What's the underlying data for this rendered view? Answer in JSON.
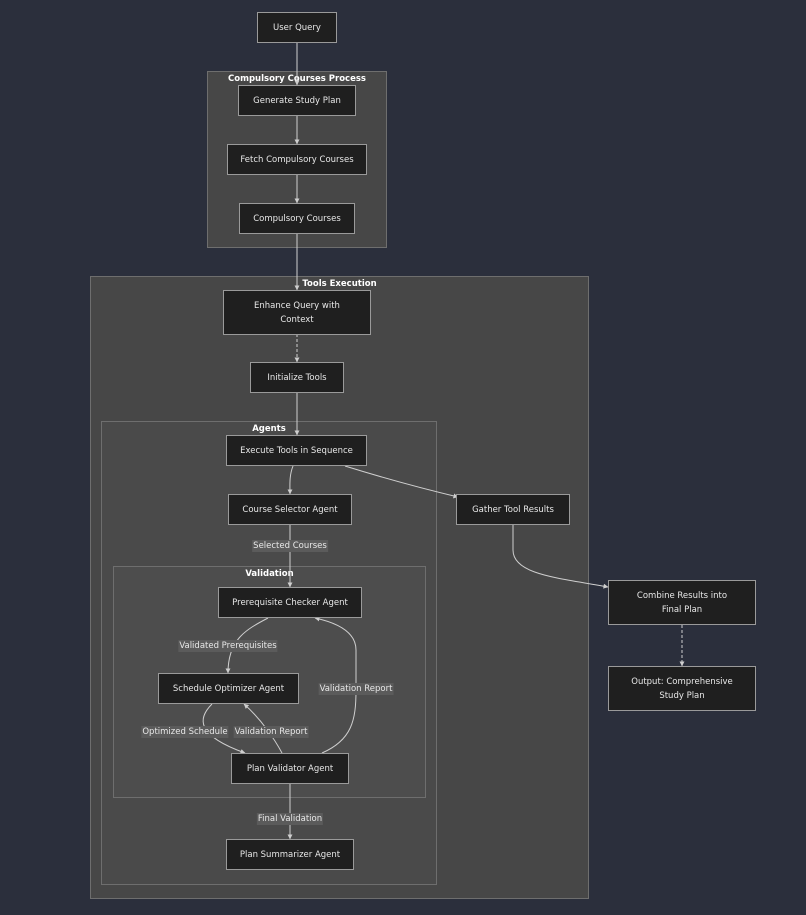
{
  "clusters": {
    "compulsory": {
      "title": "Compulsory Courses Process"
    },
    "tools": {
      "title": "Tools Execution"
    },
    "agents": {
      "title": "Agents"
    },
    "validation": {
      "title": "Validation"
    }
  },
  "nodes": {
    "user_query": "User Query",
    "generate_plan": "Generate Study Plan",
    "fetch_compulsory": "Fetch Compulsory Courses",
    "compulsory_courses": "Compulsory Courses",
    "enhance_query": "Enhance Query with Context",
    "init_tools": "Initialize Tools",
    "exec_tools": "Execute Tools in Sequence",
    "course_selector": "Course Selector Agent",
    "gather_results": "Gather Tool Results",
    "prereq_checker": "Prerequisite Checker Agent",
    "schedule_optimizer": "Schedule Optimizer Agent",
    "plan_validator": "Plan Validator Agent",
    "plan_summarizer": "Plan Summarizer Agent",
    "combine_results": "Combine Results into Final Plan",
    "output": "Output: Comprehensive Study Plan"
  },
  "edge_labels": {
    "selected_courses": "Selected Courses",
    "validated_prereqs": "Validated Prerequisites",
    "validation_report_right": "Validation Report",
    "optimized_schedule": "Optimized Schedule",
    "validation_report_mid": "Validation Report",
    "final_validation": "Final Validation"
  },
  "colors": {
    "background": "#2b2f3c",
    "cluster_fill": "#474747",
    "node_fill": "#1f1f1f",
    "edge": "#cfcfcf"
  }
}
